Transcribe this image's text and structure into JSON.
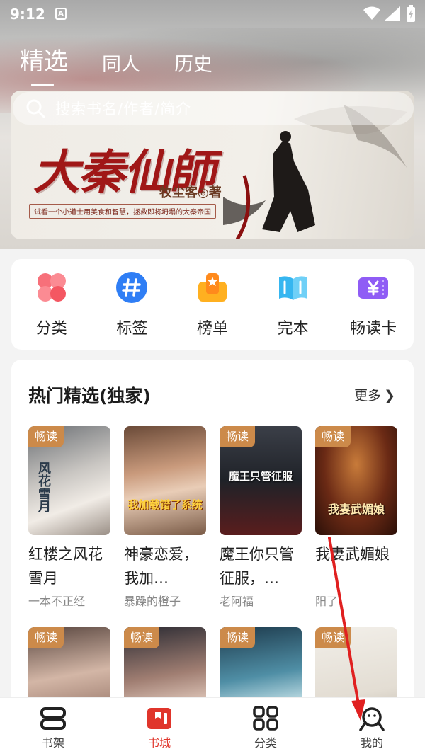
{
  "status_bar": {
    "time": "9:12",
    "badge": "A"
  },
  "top_tabs": [
    {
      "label": "精选",
      "active": true
    },
    {
      "label": "同人",
      "active": false
    },
    {
      "label": "历史",
      "active": false
    }
  ],
  "search": {
    "placeholder": "搜索书名/作者/简介",
    "icon": "search-icon"
  },
  "banner": {
    "title": "大秦仙師",
    "author": "牧尘客◎著",
    "slogan": "试看一个小道士用美食和智慧，拯救即将坍塌的大秦帝国",
    "title_color": "#a01717"
  },
  "quick_entries": [
    {
      "label": "分类",
      "icon": "clover-icon"
    },
    {
      "label": "标签",
      "icon": "hashtag-icon"
    },
    {
      "label": "榜单",
      "icon": "ranking-icon"
    },
    {
      "label": "完本",
      "icon": "open-book-icon"
    },
    {
      "label": "畅读卡",
      "icon": "yen-ticket-icon"
    }
  ],
  "hot_section": {
    "title": "热门精选(独家)",
    "more": "更多",
    "books": [
      {
        "tag": "畅读",
        "title": "红楼之风花雪月",
        "author": "一本不正经",
        "cover_text": "风花雪月"
      },
      {
        "tag": "畅读",
        "title": "神豪恋爱，我加…",
        "author": "暴躁的橙子",
        "cover_text": "我加载错了系统"
      },
      {
        "tag": "畅读",
        "title": "魔王你只管征服，…",
        "author": "老阿福",
        "cover_text": "魔王只管征服"
      },
      {
        "tag": "畅读",
        "title": "我妻武媚娘",
        "author": "阳了",
        "cover_text": "我妻武媚娘"
      },
      {
        "tag": "畅读"
      },
      {
        "tag": "畅读"
      },
      {
        "tag": "畅读"
      },
      {
        "tag": "畅读"
      }
    ]
  },
  "bottom_nav": [
    {
      "label": "书架",
      "icon": "bookshelf-icon",
      "active": false
    },
    {
      "label": "书城",
      "icon": "bookstore-icon",
      "active": true
    },
    {
      "label": "分类",
      "icon": "category-grid-icon",
      "active": false
    },
    {
      "label": "我的",
      "icon": "profile-icon",
      "active": false
    }
  ],
  "colors": {
    "accent_red": "#e0352b",
    "tag_orange": "#cc8a4a",
    "annotation_arrow": "#e02020"
  }
}
